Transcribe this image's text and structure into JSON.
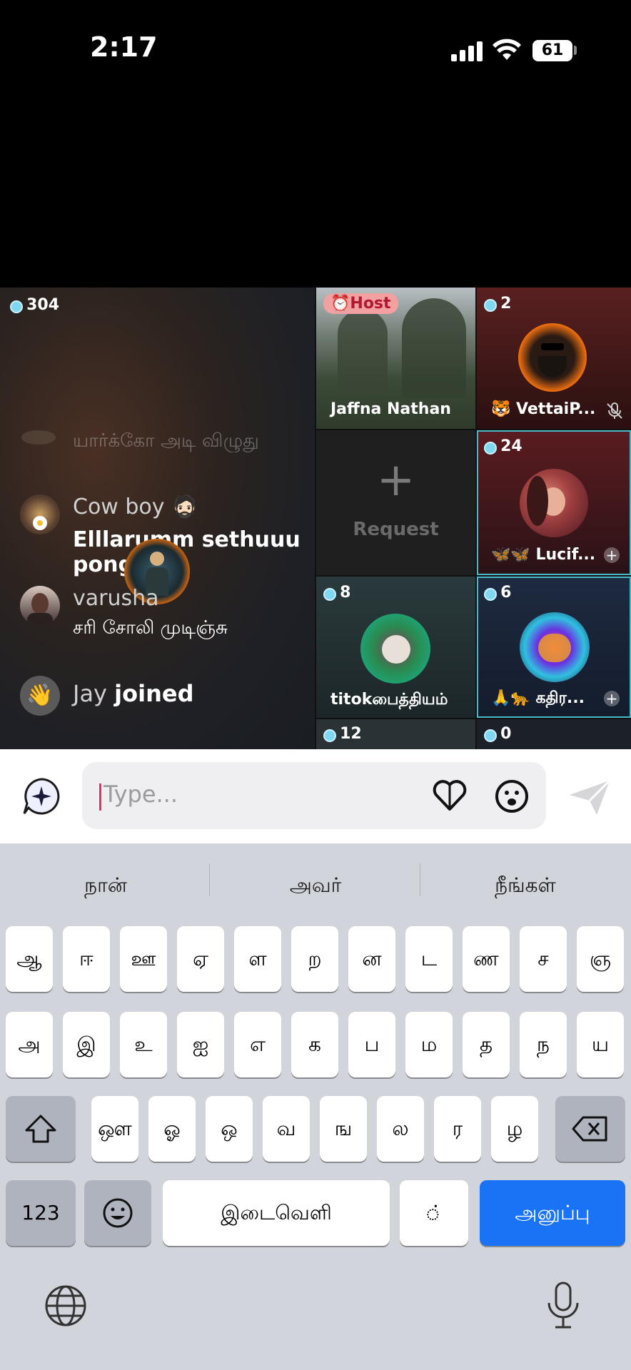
{
  "status_bar": {
    "time": "2:17",
    "battery": "61"
  },
  "main_panel": {
    "coin_count": "304",
    "chat": [
      {
        "name": "",
        "message": "யார்க்கோ அடி விழுது"
      },
      {
        "name": "Cow boy 🧔🏻",
        "message": "Elllarumm sethuuu pongo"
      },
      {
        "name": "varusha",
        "message": "சரி சோலி முடிஞ்சு"
      },
      {
        "name": "Jay",
        "message": "joined"
      }
    ]
  },
  "tiles": {
    "host": {
      "badge": "Host",
      "name": "Jaffna Nathan"
    },
    "vettai": {
      "count": "2",
      "name": "🐯 VettaiP..."
    },
    "request": {
      "label": "Request",
      "plus": "+"
    },
    "lucif": {
      "count": "24",
      "name": "🦋🦋 Lucif...",
      "plus": "+"
    },
    "titok": {
      "count": "8",
      "name": "titokபைத்தியம்"
    },
    "kathir": {
      "count": "6",
      "name": "🙏🐆 கதிர...",
      "plus": "+"
    },
    "bottom_left": {
      "count": "12"
    },
    "bottom_right": {
      "count": "0"
    }
  },
  "input": {
    "placeholder": "Type..."
  },
  "keyboard": {
    "suggestions": [
      "நான்",
      "அவர்",
      "நீங்கள்"
    ],
    "row1": [
      "ஆ",
      "ஈ",
      "ஊ",
      "ஏ",
      "ள",
      "ற",
      "ன",
      "ட",
      "ண",
      "ச",
      "ஞ"
    ],
    "row2": [
      "அ",
      "இ",
      "உ",
      "ஐ",
      "எ",
      "க",
      "ப",
      "ம",
      "த",
      "ந",
      "ய"
    ],
    "row3": [
      "ஔ",
      "ஓ",
      "ஒ",
      "வ",
      "ங",
      "ல",
      "ர",
      "ழ"
    ],
    "numbers_label": "123",
    "space_label": "இடைவெளி",
    "dot_key": "் ",
    "send_label": "அனுப்பு"
  },
  "colors": {
    "accent_blue": "#1a73f5",
    "caret": "#e8305a",
    "coin": "#7fd8f0",
    "host_badge": "#f2a0a0"
  }
}
